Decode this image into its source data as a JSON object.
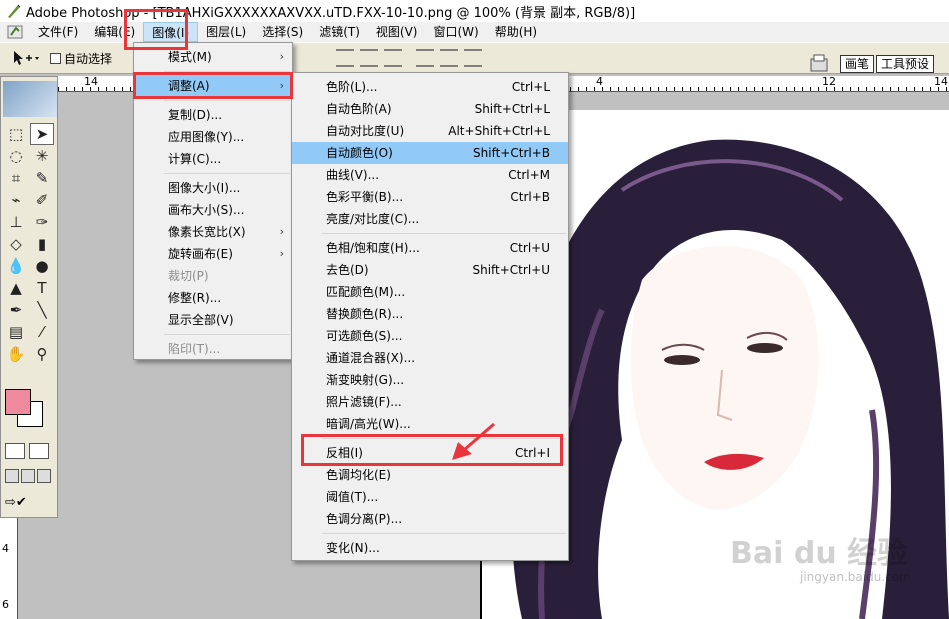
{
  "window": {
    "title": "Adobe Photoshop - [TB1AHXiGXXXXXXAXVXX.uTD.FXX-10-10.png @ 100% (背景 副本, RGB/8)]"
  },
  "menubar": {
    "items": [
      {
        "label": "文件(F)"
      },
      {
        "label": "编辑(E)"
      },
      {
        "label": "图像(I)"
      },
      {
        "label": "图层(L)"
      },
      {
        "label": "选择(S)"
      },
      {
        "label": "滤镜(T)"
      },
      {
        "label": "视图(V)"
      },
      {
        "label": "窗口(W)"
      },
      {
        "label": "帮助(H)"
      }
    ]
  },
  "options": {
    "auto_select_label": "自动选择"
  },
  "palette_well": {
    "tabs": [
      "画笔",
      "工具预设"
    ]
  },
  "ruler": {
    "h_ticks": [
      "14",
      "4",
      "12",
      "14"
    ],
    "v_ticks": [
      "4",
      "6"
    ]
  },
  "image_menu": {
    "items": [
      {
        "label": "模式(M)",
        "submenu": true
      },
      {
        "label": "调整(A)",
        "submenu": true,
        "highlighted": true
      },
      {
        "label": "复制(D)..."
      },
      {
        "label": "应用图像(Y)..."
      },
      {
        "label": "计算(C)..."
      },
      {
        "label": "图像大小(I)..."
      },
      {
        "label": "画布大小(S)..."
      },
      {
        "label": "像素长宽比(X)",
        "submenu": true
      },
      {
        "label": "旋转画布(E)",
        "submenu": true
      },
      {
        "label": "裁切(P)",
        "disabled": true
      },
      {
        "label": "修整(R)..."
      },
      {
        "label": "显示全部(V)"
      },
      {
        "label": "陷印(T)...",
        "disabled": true
      }
    ]
  },
  "adjust_menu": {
    "items": [
      {
        "label": "色阶(L)...",
        "shortcut": "Ctrl+L"
      },
      {
        "label": "自动色阶(A)",
        "shortcut": "Shift+Ctrl+L"
      },
      {
        "label": "自动对比度(U)",
        "shortcut": "Alt+Shift+Ctrl+L"
      },
      {
        "label": "自动颜色(O)",
        "shortcut": "Shift+Ctrl+B",
        "highlighted": true
      },
      {
        "label": "曲线(V)...",
        "shortcut": "Ctrl+M"
      },
      {
        "label": "色彩平衡(B)...",
        "shortcut": "Ctrl+B"
      },
      {
        "label": "亮度/对比度(C)...",
        "shortcut": ""
      },
      {
        "label": "色相/饱和度(H)...",
        "shortcut": "Ctrl+U"
      },
      {
        "label": "去色(D)",
        "shortcut": "Shift+Ctrl+U"
      },
      {
        "label": "匹配颜色(M)...",
        "shortcut": ""
      },
      {
        "label": "替换颜色(R)...",
        "shortcut": ""
      },
      {
        "label": "可选颜色(S)...",
        "shortcut": ""
      },
      {
        "label": "通道混合器(X)...",
        "shortcut": ""
      },
      {
        "label": "渐变映射(G)...",
        "shortcut": ""
      },
      {
        "label": "照片滤镜(F)...",
        "shortcut": ""
      },
      {
        "label": "暗调/高光(W)...",
        "shortcut": ""
      },
      {
        "label": "反相(I)",
        "shortcut": "Ctrl+I"
      },
      {
        "label": "色调均化(E)",
        "shortcut": ""
      },
      {
        "label": "阈值(T)...",
        "shortcut": ""
      },
      {
        "label": "色调分离(P)...",
        "shortcut": ""
      },
      {
        "label": "变化(N)...",
        "shortcut": ""
      }
    ]
  },
  "watermark": {
    "brand": "Bai du 经验",
    "url": "jingyan.baidu.com"
  },
  "colors": {
    "foreground": "#f08a9e",
    "background": "#ffffff",
    "menu_highlight": "#91c9f7",
    "annotation_red": "#e8363c"
  }
}
